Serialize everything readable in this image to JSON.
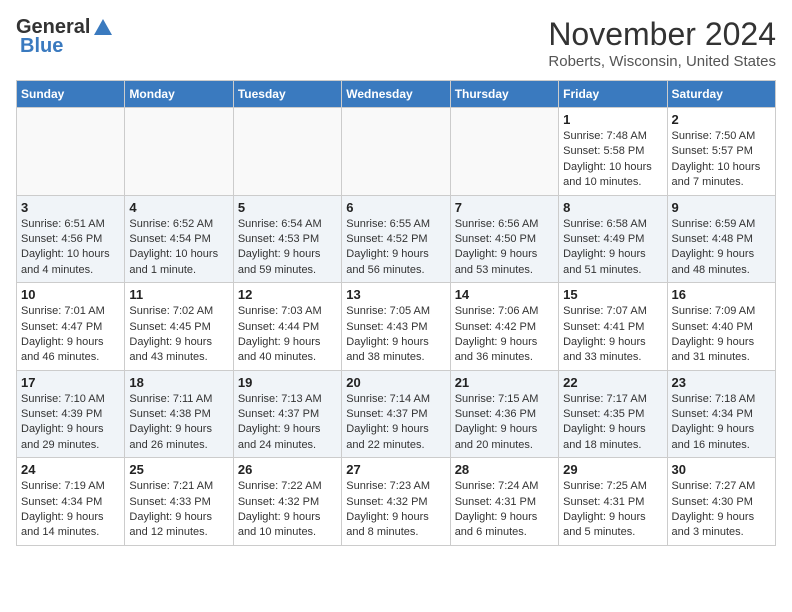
{
  "logo": {
    "general": "General",
    "blue": "Blue"
  },
  "title": "November 2024",
  "location": "Roberts, Wisconsin, United States",
  "days_header": [
    "Sunday",
    "Monday",
    "Tuesday",
    "Wednesday",
    "Thursday",
    "Friday",
    "Saturday"
  ],
  "weeks": [
    [
      {
        "day": "",
        "info": ""
      },
      {
        "day": "",
        "info": ""
      },
      {
        "day": "",
        "info": ""
      },
      {
        "day": "",
        "info": ""
      },
      {
        "day": "",
        "info": ""
      },
      {
        "day": "1",
        "info": "Sunrise: 7:48 AM\nSunset: 5:58 PM\nDaylight: 10 hours and 10 minutes."
      },
      {
        "day": "2",
        "info": "Sunrise: 7:50 AM\nSunset: 5:57 PM\nDaylight: 10 hours and 7 minutes."
      }
    ],
    [
      {
        "day": "3",
        "info": "Sunrise: 6:51 AM\nSunset: 4:56 PM\nDaylight: 10 hours and 4 minutes."
      },
      {
        "day": "4",
        "info": "Sunrise: 6:52 AM\nSunset: 4:54 PM\nDaylight: 10 hours and 1 minute."
      },
      {
        "day": "5",
        "info": "Sunrise: 6:54 AM\nSunset: 4:53 PM\nDaylight: 9 hours and 59 minutes."
      },
      {
        "day": "6",
        "info": "Sunrise: 6:55 AM\nSunset: 4:52 PM\nDaylight: 9 hours and 56 minutes."
      },
      {
        "day": "7",
        "info": "Sunrise: 6:56 AM\nSunset: 4:50 PM\nDaylight: 9 hours and 53 minutes."
      },
      {
        "day": "8",
        "info": "Sunrise: 6:58 AM\nSunset: 4:49 PM\nDaylight: 9 hours and 51 minutes."
      },
      {
        "day": "9",
        "info": "Sunrise: 6:59 AM\nSunset: 4:48 PM\nDaylight: 9 hours and 48 minutes."
      }
    ],
    [
      {
        "day": "10",
        "info": "Sunrise: 7:01 AM\nSunset: 4:47 PM\nDaylight: 9 hours and 46 minutes."
      },
      {
        "day": "11",
        "info": "Sunrise: 7:02 AM\nSunset: 4:45 PM\nDaylight: 9 hours and 43 minutes."
      },
      {
        "day": "12",
        "info": "Sunrise: 7:03 AM\nSunset: 4:44 PM\nDaylight: 9 hours and 40 minutes."
      },
      {
        "day": "13",
        "info": "Sunrise: 7:05 AM\nSunset: 4:43 PM\nDaylight: 9 hours and 38 minutes."
      },
      {
        "day": "14",
        "info": "Sunrise: 7:06 AM\nSunset: 4:42 PM\nDaylight: 9 hours and 36 minutes."
      },
      {
        "day": "15",
        "info": "Sunrise: 7:07 AM\nSunset: 4:41 PM\nDaylight: 9 hours and 33 minutes."
      },
      {
        "day": "16",
        "info": "Sunrise: 7:09 AM\nSunset: 4:40 PM\nDaylight: 9 hours and 31 minutes."
      }
    ],
    [
      {
        "day": "17",
        "info": "Sunrise: 7:10 AM\nSunset: 4:39 PM\nDaylight: 9 hours and 29 minutes."
      },
      {
        "day": "18",
        "info": "Sunrise: 7:11 AM\nSunset: 4:38 PM\nDaylight: 9 hours and 26 minutes."
      },
      {
        "day": "19",
        "info": "Sunrise: 7:13 AM\nSunset: 4:37 PM\nDaylight: 9 hours and 24 minutes."
      },
      {
        "day": "20",
        "info": "Sunrise: 7:14 AM\nSunset: 4:37 PM\nDaylight: 9 hours and 22 minutes."
      },
      {
        "day": "21",
        "info": "Sunrise: 7:15 AM\nSunset: 4:36 PM\nDaylight: 9 hours and 20 minutes."
      },
      {
        "day": "22",
        "info": "Sunrise: 7:17 AM\nSunset: 4:35 PM\nDaylight: 9 hours and 18 minutes."
      },
      {
        "day": "23",
        "info": "Sunrise: 7:18 AM\nSunset: 4:34 PM\nDaylight: 9 hours and 16 minutes."
      }
    ],
    [
      {
        "day": "24",
        "info": "Sunrise: 7:19 AM\nSunset: 4:34 PM\nDaylight: 9 hours and 14 minutes."
      },
      {
        "day": "25",
        "info": "Sunrise: 7:21 AM\nSunset: 4:33 PM\nDaylight: 9 hours and 12 minutes."
      },
      {
        "day": "26",
        "info": "Sunrise: 7:22 AM\nSunset: 4:32 PM\nDaylight: 9 hours and 10 minutes."
      },
      {
        "day": "27",
        "info": "Sunrise: 7:23 AM\nSunset: 4:32 PM\nDaylight: 9 hours and 8 minutes."
      },
      {
        "day": "28",
        "info": "Sunrise: 7:24 AM\nSunset: 4:31 PM\nDaylight: 9 hours and 6 minutes."
      },
      {
        "day": "29",
        "info": "Sunrise: 7:25 AM\nSunset: 4:31 PM\nDaylight: 9 hours and 5 minutes."
      },
      {
        "day": "30",
        "info": "Sunrise: 7:27 AM\nSunset: 4:30 PM\nDaylight: 9 hours and 3 minutes."
      }
    ]
  ]
}
